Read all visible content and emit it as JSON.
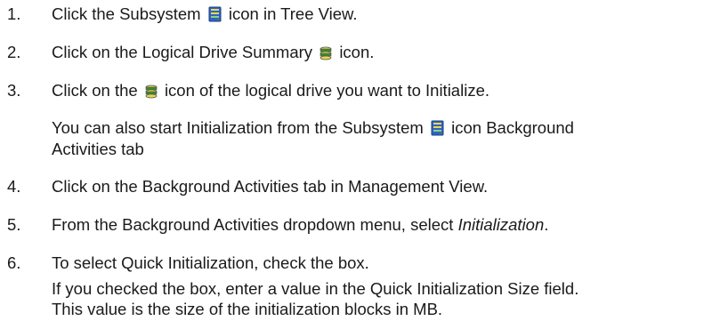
{
  "steps": [
    {
      "num": "1.",
      "before": "Click the Subsystem",
      "icon": "subsystem-icon",
      "after": "icon in Tree View."
    },
    {
      "num": "2.",
      "before": "Click on the Logical Drive Summary",
      "icon": "logical-drive-summary-icon",
      "after": "icon."
    },
    {
      "num": "3.",
      "before": "Click on the",
      "icon": "logical-drive-icon",
      "after": "icon of the logical drive you want to Initialize."
    },
    {
      "num": "4.",
      "text": "Click on the Background Activities tab in Management View."
    },
    {
      "num": "5.",
      "before": "From the Background Activities dropdown menu, select",
      "emph": "Initialization",
      "after": "."
    },
    {
      "num": "6.",
      "text": "To select Quick Initialization, check the box."
    }
  ],
  "note_after_step3": {
    "line1_before": "You can also start Initialization from the Subsystem",
    "icon": "subsystem-icon",
    "line1_after": "icon Background",
    "line2": "Activities tab"
  },
  "note_after_step6": {
    "line1": "If you checked the box, enter a value in the Quick Initialization Size field.",
    "line2": "This value is the size of the initialization blocks in MB."
  },
  "colors": {
    "text": "#1a1a1a",
    "icon_blue": "#2f63c8",
    "icon_green": "#3a8a2e",
    "icon_yellow": "#e9d84a"
  }
}
